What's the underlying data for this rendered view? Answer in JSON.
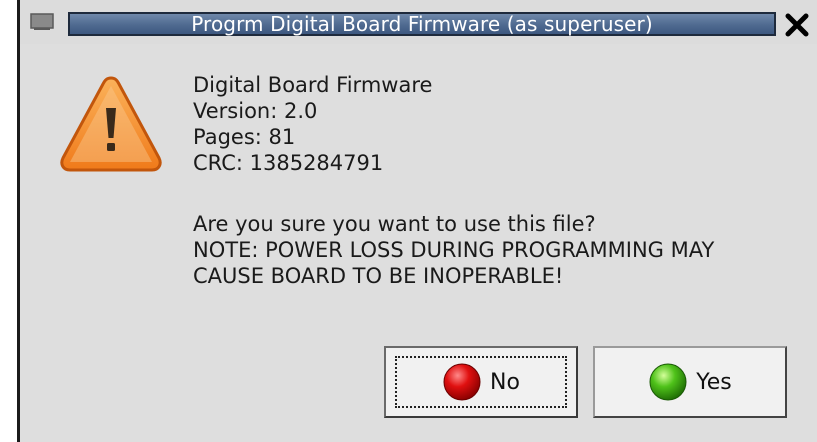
{
  "window": {
    "title": "Progrm Digital Board Firmware (as superuser)"
  },
  "icons": {
    "window_menu": "window-menu-icon",
    "close": "close-icon",
    "warning": "warning-icon",
    "no": "red-circle-icon",
    "yes": "green-circle-icon"
  },
  "firmware": {
    "name": "Digital Board Firmware",
    "version": "Version: 2.0",
    "pages": "Pages: 81",
    "crc": "CRC: 1385284791"
  },
  "message": {
    "question": "Are you sure you want to use this file?",
    "note_line1": "NOTE: POWER LOSS DURING PROGRAMMING MAY",
    "note_line2": "CAUSE BOARD TO BE INOPERABLE!"
  },
  "buttons": {
    "no_label": "No",
    "yes_label": "Yes"
  },
  "colors": {
    "titlebar_active": "#4f6a90",
    "dialog_bg": "#dedede",
    "warning_orange": "#f07a1a",
    "no_red": "#e01010",
    "yes_green": "#4fc21a"
  }
}
